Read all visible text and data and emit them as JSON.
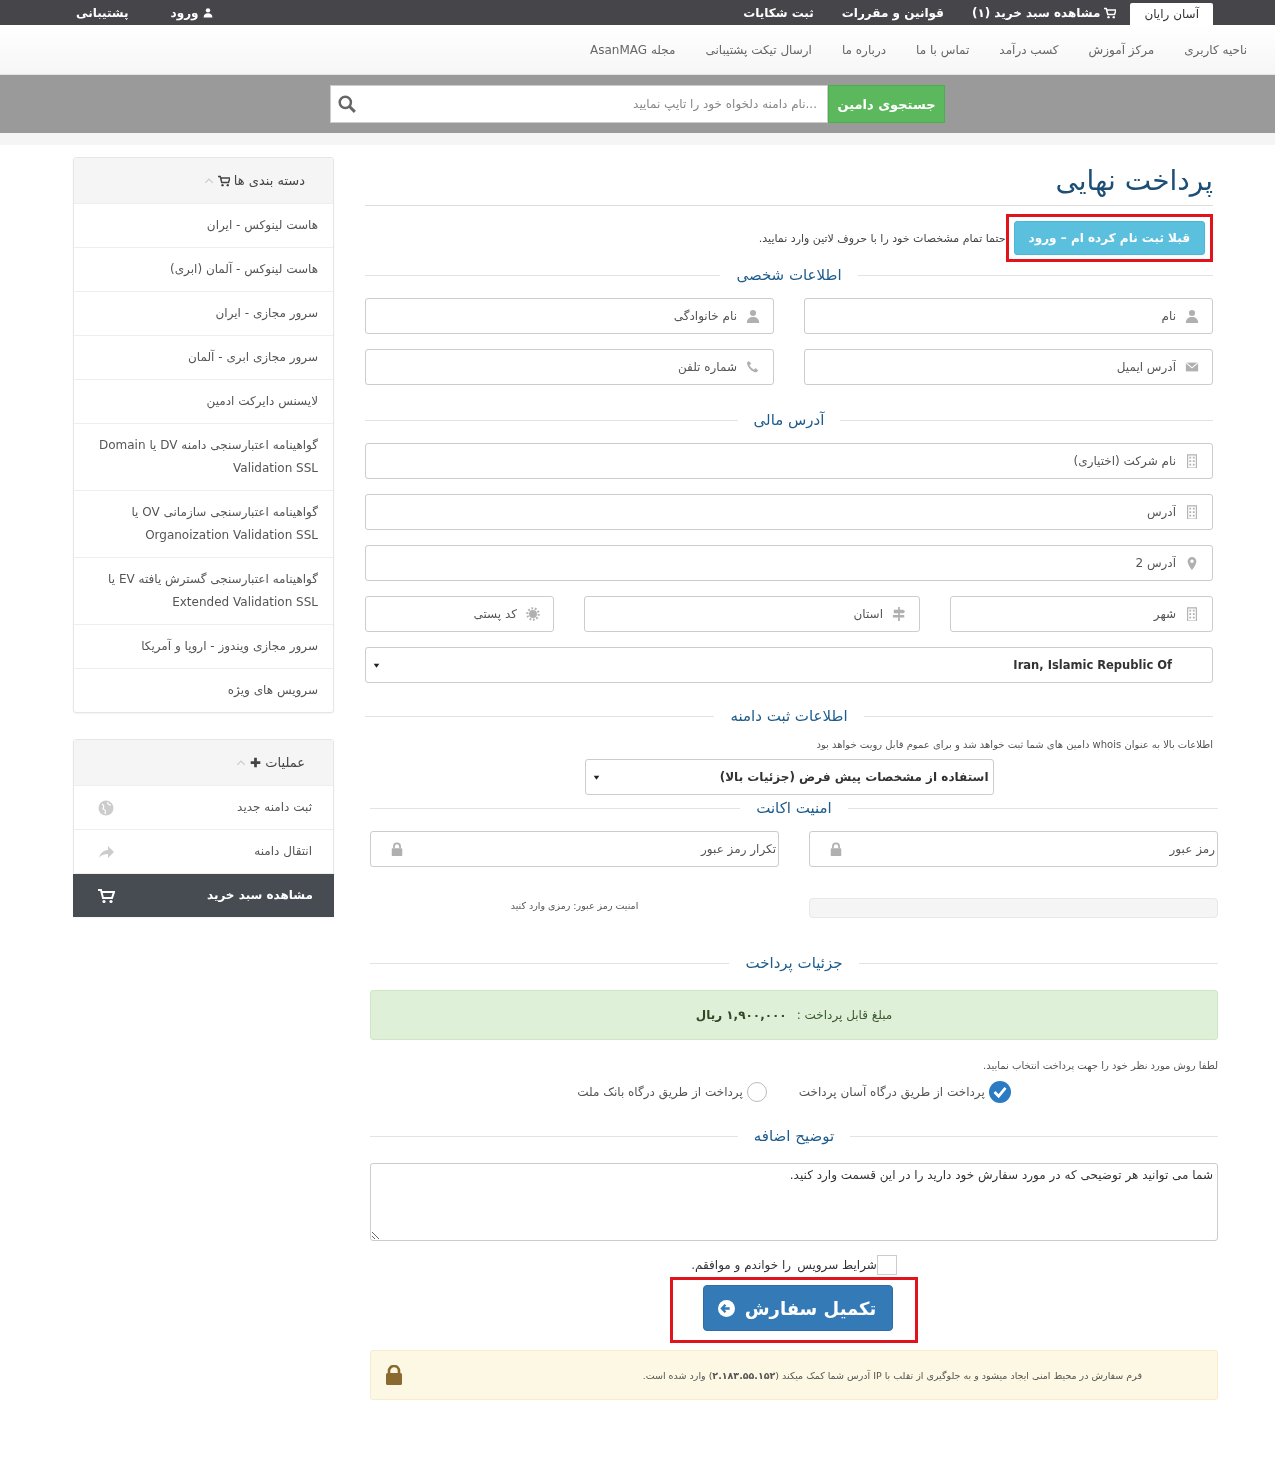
{
  "top_bar": {
    "tabs": [
      {
        "label": "آسان رایان",
        "selected": true
      },
      {
        "label": "مشاهده سبد خرید (۱)",
        "selected": false
      },
      {
        "label": "قوانین و مقررات",
        "selected": false
      },
      {
        "label": "ثبت شکایات",
        "selected": false
      }
    ],
    "login": "ورود",
    "support": "پشتیبانی"
  },
  "nav": {
    "items": [
      "ناحیه کاربری",
      "مرکز آموزش",
      "کسب درآمد",
      "تماس با ما",
      "درباره ما",
      "ارسال تیکت پشتیبانی",
      "مجله AsanMAG"
    ]
  },
  "domain_search": {
    "button": "جستجوی دامین",
    "placeholder": "...نام دامنه دلخواه خود را تایپ نمایید"
  },
  "sidebar": {
    "categories": {
      "title": "دسته بندی ها",
      "items": [
        "هاست لینوکس - ایران",
        "هاست لینوکس - آلمان (ابری)",
        "سرور مجازی - ایران",
        "سرور مجازی ابری - آلمان",
        "لایسنس دایرکت ادمین",
        "گواهینامه اعتبارسنجی دامنه DV یا Domain Validation SSL",
        "گواهینامه اعتبارسنجی سازمانی OV یا Organoization Validation SSL",
        "گواهینامه اعتبارسنجی گسترش یافته EV یا Extended Validation SSL",
        "سرور مجازی ویندوز - اروپا و آمریکا",
        "سرویس های ویژه"
      ]
    },
    "actions": {
      "title": "عملیات",
      "items": [
        {
          "label": "ثبت دامنه جدید",
          "selected": false
        },
        {
          "label": "انتقال دامنه",
          "selected": false
        },
        {
          "label": "مشاهده سبد خرید",
          "selected": true
        }
      ]
    }
  },
  "checkout": {
    "title": "پرداخت نهایی",
    "login_button": {
      "label": "قبلا ثبت نام کرده ام – ورود",
      "highlighted": true
    },
    "latin_note": "حتما تمام مشخصات خود را با حروف لاتین وارد نمایید.",
    "personal": {
      "heading": "اطلاعات شخصی",
      "fields": [
        {
          "placeholder": "نام"
        },
        {
          "placeholder": "نام خانوادگی"
        },
        {
          "placeholder": "آدرس ایمیل"
        },
        {
          "placeholder": "شماره تلفن"
        }
      ]
    },
    "billing": {
      "heading": "آدرس مالی",
      "fields": [
        {
          "placeholder": "نام شرکت (اختیاری)"
        },
        {
          "placeholder": "آدرس"
        },
        {
          "placeholder": "آدرس 2"
        },
        {
          "placeholder": "شهر"
        },
        {
          "placeholder": "استان"
        },
        {
          "placeholder": "کد پستی"
        }
      ],
      "country": "Iran, Islamic Republic Of"
    },
    "domain": {
      "heading": "اطلاعات ثبت دامنه",
      "note": "اطلاعات بالا به عنوان whois دامین های شما ثبت خواهد شد و برای عموم قابل رویت خواهد بود",
      "contact": "استفاده از مشخصات پیش فرض (جزئیات بالا)"
    },
    "security": {
      "heading": "امنیت اکانت",
      "password": {
        "placeholder": "رمز عبور"
      },
      "confirm": {
        "placeholder": "تکرار رمز عبور"
      },
      "strength": {
        "level": 0
      },
      "strength_text": "امنیت رمز عبور: رمزی وارد کنید"
    },
    "payment": {
      "heading": "جزئیات پرداخت",
      "amount_label": "مبلغ قابل پرداخت :",
      "amount": "۱,۹۰۰,۰۰۰ ریال",
      "instruction": "لطفا روش مورد نظر خود را جهت پرداخت انتخاب نمایید.",
      "methods": [
        {
          "label": "پرداخت از طریق درگاه آسان پرداخت",
          "selected": true
        },
        {
          "label": "پرداخت از طریق درگاه بانک ملت",
          "selected": false
        }
      ]
    },
    "notes": {
      "heading": "توضیح اضافه",
      "placeholder": "شما می توانید هر توضیحی که در مورد سفارش خود دارید را در این قسمت وارد کنید."
    },
    "terms": {
      "checked": false,
      "link": "شرایط سرویس",
      "text": "را خواندم و موافقم."
    },
    "submit": {
      "label": "تکمیل سفارش",
      "highlighted": true
    },
    "security_notice": "فرم سفارش در محیط امنی ایجاد میشود و به جلوگیری از تقلب با IP آدرس شما کمک میکند (**۲.۱۸۳.۵۵.۱۵۲**) وارد شده است."
  }
}
